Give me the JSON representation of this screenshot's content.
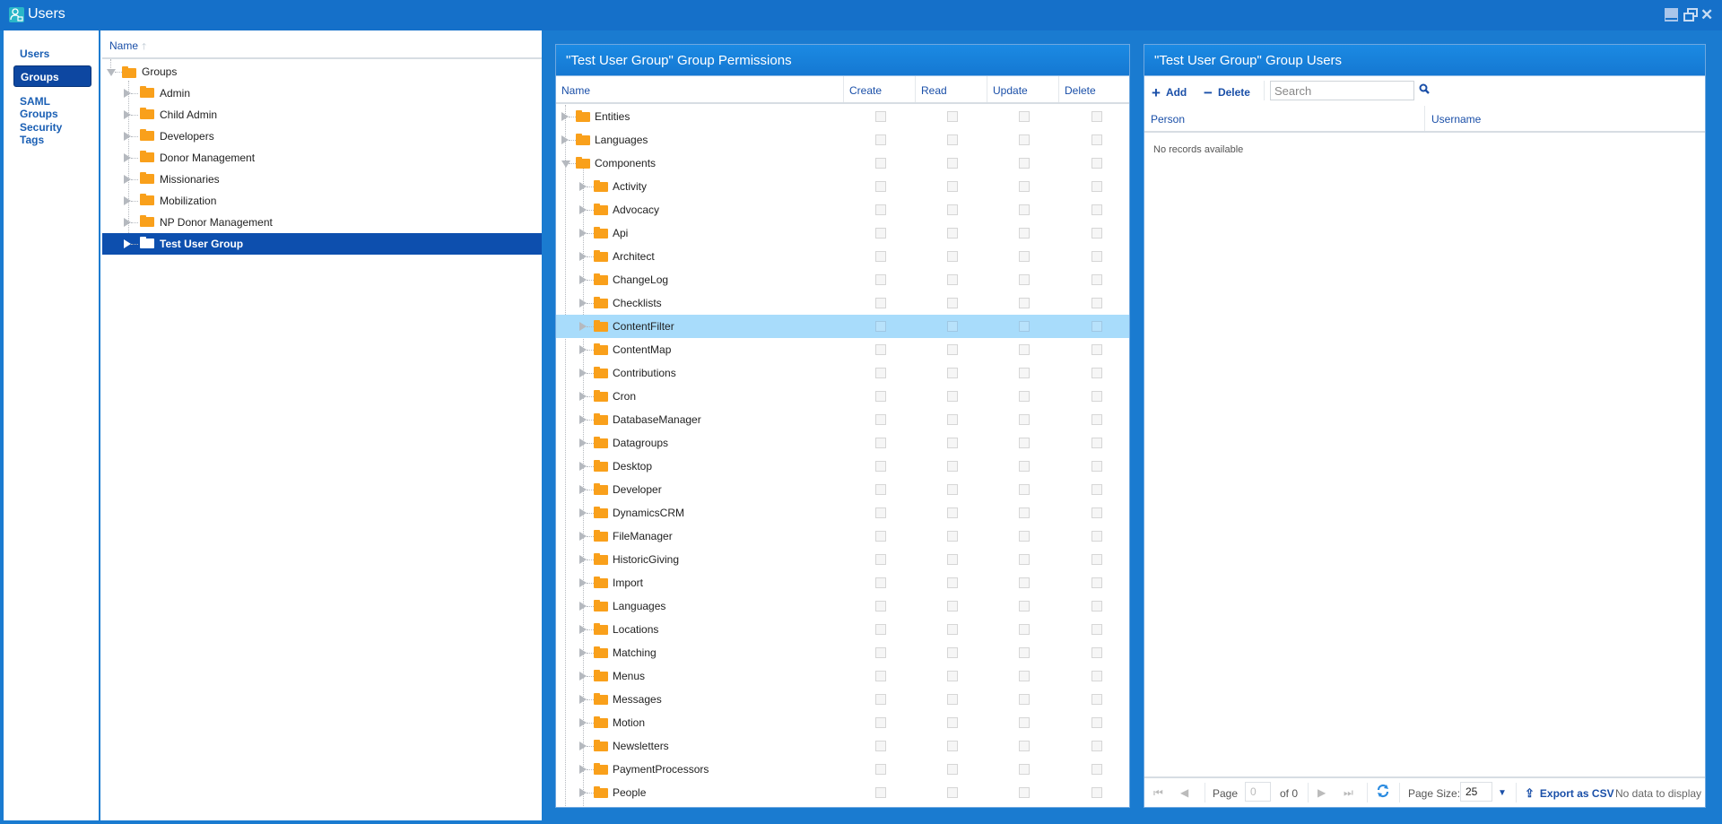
{
  "window": {
    "title": "Users",
    "icon": "users-icon",
    "controls": [
      "minimize-icon",
      "restore-icon",
      "close-icon"
    ]
  },
  "sidebar": {
    "items": [
      {
        "label": "Users",
        "active": false
      },
      {
        "label": "Groups",
        "active": true
      },
      {
        "label": "SAML Groups",
        "active": false
      },
      {
        "label": "Security Tags",
        "active": false
      }
    ]
  },
  "group_tree": {
    "column_header": "Name",
    "sort": "ascending",
    "root": {
      "label": "Groups",
      "expanded": true
    },
    "children": [
      {
        "label": "Admin"
      },
      {
        "label": "Child Admin"
      },
      {
        "label": "Developers"
      },
      {
        "label": "Donor Management"
      },
      {
        "label": "Missionaries"
      },
      {
        "label": "Mobilization"
      },
      {
        "label": "NP Donor Management"
      },
      {
        "label": "Test User Group",
        "selected": true
      }
    ]
  },
  "permissions": {
    "title": "\"Test User Group\" Group Permissions",
    "columns": [
      "Name",
      "Create",
      "Read",
      "Update",
      "Delete"
    ],
    "rows": [
      {
        "label": "Entities",
        "level": 0,
        "expanded": false
      },
      {
        "label": "Languages",
        "level": 0,
        "expanded": false
      },
      {
        "label": "Components",
        "level": 0,
        "expanded": true
      },
      {
        "label": "Activity",
        "level": 1
      },
      {
        "label": "Advocacy",
        "level": 1
      },
      {
        "label": "Api",
        "level": 1
      },
      {
        "label": "Architect",
        "level": 1
      },
      {
        "label": "ChangeLog",
        "level": 1
      },
      {
        "label": "Checklists",
        "level": 1
      },
      {
        "label": "ContentFilter",
        "level": 1,
        "highlighted": true
      },
      {
        "label": "ContentMap",
        "level": 1
      },
      {
        "label": "Contributions",
        "level": 1
      },
      {
        "label": "Cron",
        "level": 1
      },
      {
        "label": "DatabaseManager",
        "level": 1
      },
      {
        "label": "Datagroups",
        "level": 1
      },
      {
        "label": "Desktop",
        "level": 1
      },
      {
        "label": "Developer",
        "level": 1
      },
      {
        "label": "DynamicsCRM",
        "level": 1
      },
      {
        "label": "FileManager",
        "level": 1
      },
      {
        "label": "HistoricGiving",
        "level": 1
      },
      {
        "label": "Import",
        "level": 1
      },
      {
        "label": "Languages",
        "level": 1
      },
      {
        "label": "Locations",
        "level": 1
      },
      {
        "label": "Matching",
        "level": 1
      },
      {
        "label": "Menus",
        "level": 1
      },
      {
        "label": "Messages",
        "level": 1
      },
      {
        "label": "Motion",
        "level": 1
      },
      {
        "label": "Newsletters",
        "level": 1
      },
      {
        "label": "PaymentProcessors",
        "level": 1
      },
      {
        "label": "People",
        "level": 1
      }
    ],
    "checked": {
      "create": false,
      "read": false,
      "update": false,
      "delete": false
    }
  },
  "group_users": {
    "title": "\"Test User Group\" Group Users",
    "toolbar": {
      "add_label": "Add",
      "delete_label": "Delete",
      "search_placeholder": "Search",
      "search_value": ""
    },
    "columns": [
      "Person",
      "Username"
    ],
    "empty_message": "No records available",
    "pager": {
      "page_label": "Page",
      "page_value": "0",
      "of_label": "of 0",
      "page_size_label": "Page Size:",
      "page_size": "25",
      "export_label": "Export as CSV",
      "status": "No data to display"
    }
  },
  "colors": {
    "accent": "#1a7bd0",
    "selected": "#0d4fae",
    "row_highlight": "#a8dcfb",
    "folder": "#f9a01b"
  }
}
